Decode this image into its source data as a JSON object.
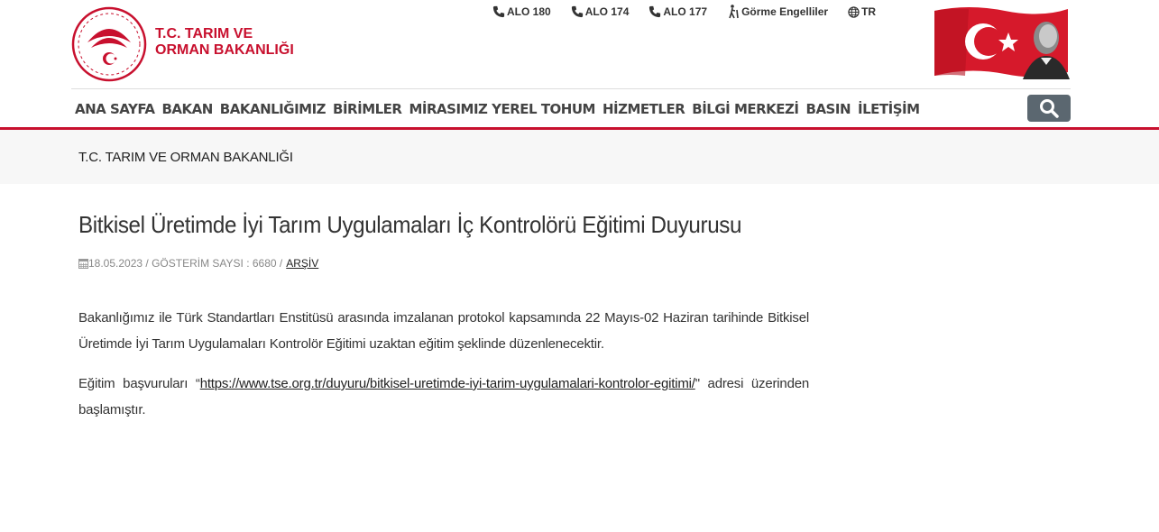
{
  "header": {
    "logo_line1": "T.C. TARIM VE",
    "logo_line2": "ORMAN BAKANLIĞI",
    "top_links": [
      {
        "label": "ALO 180",
        "icon": "phone-icon"
      },
      {
        "label": "ALO 174",
        "icon": "phone-icon"
      },
      {
        "label": "ALO 177",
        "icon": "phone-icon"
      },
      {
        "label": "Görme Engelliler",
        "icon": "accessibility-icon"
      },
      {
        "label": "TR",
        "icon": "globe-icon"
      }
    ],
    "brand_color": "#c8102e"
  },
  "nav": {
    "items": [
      "ANA SAYFA",
      "BAKAN",
      "BAKANLIĞIMIZ",
      "BİRİMLER",
      "MİRASIMIZ YEREL TOHUM",
      "HİZMETLER",
      "BİLGİ MERKEZİ",
      "BASIN",
      "İLETİŞİM"
    ],
    "search_icon": "search-icon"
  },
  "breadcrumb": "T.C. TARIM VE ORMAN BAKANLIĞI",
  "article": {
    "title": "Bitkisel Üretimde İyi Tarım Uygulamaları İç Kontrolörü Eğitimi Duyurusu",
    "meta": {
      "date": "18.05.2023",
      "views_label": "GÖSTERİM SAYSI : 6680",
      "archive": "ARŞİV"
    },
    "paragraph1": "Bakanlığımız ile Türk Standartları Enstitüsü arasında imzalanan protokol kapsamında 22 Mayıs-02 Haziran tarihinde Bitkisel Üretimde İyi Tarım Uygulamaları  Kontrolör Eğitimi uzaktan eğitim şeklinde düzenlenecektir.",
    "paragraph2_before": "Eğitim başvuruları “",
    "paragraph2_link": "https://www.tse.org.tr/duyuru/bitkisel-uretimde-iyi-tarim-uygulamalari-kontrolor-egitimi/",
    "paragraph2_after": "\" adresi üzerinden başlamıştır."
  }
}
